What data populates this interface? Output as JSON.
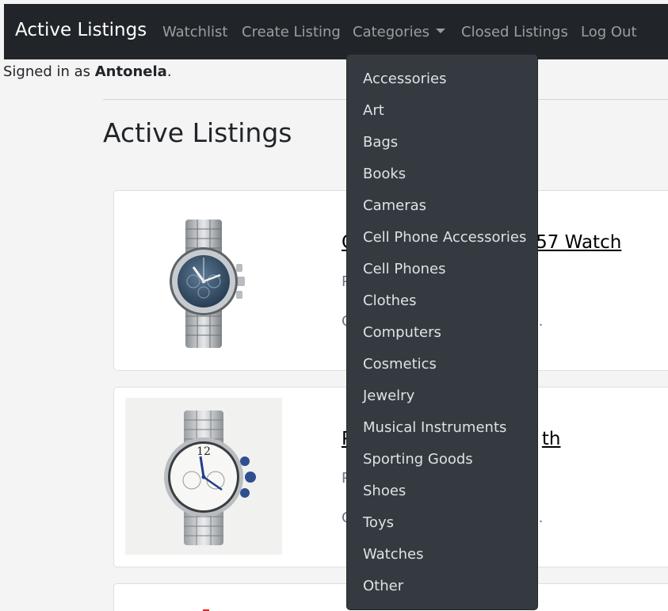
{
  "navbar": {
    "brand": "Active Listings",
    "links": [
      "Watchlist",
      "Create Listing",
      "Categories",
      "Closed Listings",
      "Log Out"
    ]
  },
  "user": {
    "prefix": "Signed in as ",
    "name": "Antonela",
    "suffix": "."
  },
  "main": {
    "title": "Active Listings",
    "listings": [
      {
        "title_visible": "57 Watch",
        "line1_visible": "P",
        "line2_visible": ".",
        "line2_initial": "C"
      },
      {
        "title_visible": "th",
        "line1_visible": "P",
        "line2_visible": ".",
        "line2_initial": "C"
      }
    ]
  },
  "categories_menu": {
    "items": [
      "Accessories",
      "Art",
      "Bags",
      "Books",
      "Cameras",
      "Cell Phone Accessories",
      "Cell Phones",
      "Clothes",
      "Computers",
      "Cosmetics",
      "Jewelry",
      "Musical Instruments",
      "Sporting Goods",
      "Shoes",
      "Toys",
      "Watches",
      "Other"
    ]
  },
  "colors": {
    "navbar_bg": "#212529",
    "dropdown_bg": "#343a40",
    "page_bg": "#f4f4f4"
  }
}
